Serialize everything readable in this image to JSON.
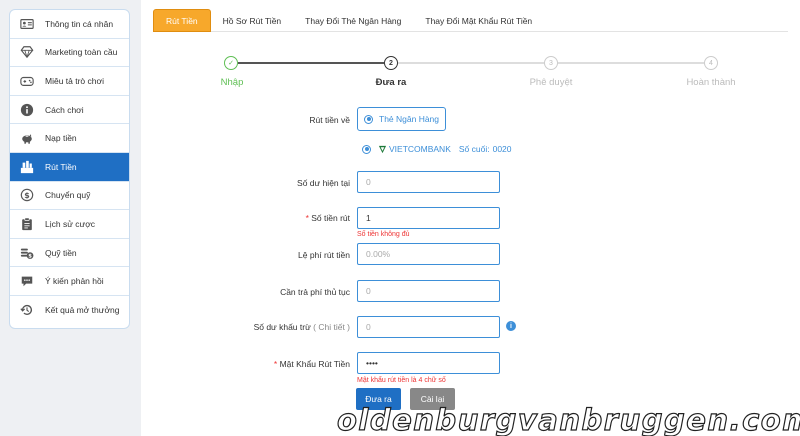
{
  "sidebar": {
    "items": [
      {
        "label": "Thông tin cá nhân",
        "icon": "id-card-icon",
        "active": false
      },
      {
        "label": "Marketing toàn cầu",
        "icon": "diamond-icon",
        "active": false
      },
      {
        "label": "Miêu tả trò chơi",
        "icon": "gamepad-icon",
        "active": false
      },
      {
        "label": "Cách chơi",
        "icon": "info-icon",
        "active": false
      },
      {
        "label": "Nạp tiền",
        "icon": "piggy-bank-icon",
        "active": false
      },
      {
        "label": "Rút Tiền",
        "icon": "withdraw-icon",
        "active": true
      },
      {
        "label": "Chuyển quỹ",
        "icon": "dollar-circle-icon",
        "active": false
      },
      {
        "label": "Lịch sử cược",
        "icon": "clipboard-icon",
        "active": false
      },
      {
        "label": "Quỹ tiền",
        "icon": "coins-icon",
        "active": false
      },
      {
        "label": "Ý kiến phản hồi",
        "icon": "chat-bubble-icon",
        "active": false
      },
      {
        "label": "Kết quả mở thưởng",
        "icon": "history-icon",
        "active": false
      }
    ]
  },
  "tabs": [
    {
      "label": "Rút Tiền",
      "active": true
    },
    {
      "label": "Hồ Sơ Rút Tiền",
      "active": false
    },
    {
      "label": "Thay Đổi Thẻ Ngân Hàng",
      "active": false
    },
    {
      "label": "Thay Đổi Mật Khẩu Rút Tiền",
      "active": false
    }
  ],
  "stepper": {
    "steps": [
      {
        "num": "✓",
        "label": "Nhập",
        "state": "done"
      },
      {
        "num": "2",
        "label": "Đưa ra",
        "state": "current"
      },
      {
        "num": "3",
        "label": "Phê duyệt",
        "state": "todo"
      },
      {
        "num": "4",
        "label": "Hoàn thành",
        "state": "todo"
      }
    ]
  },
  "form": {
    "withdraw_to_label": "Rút tiền về",
    "withdraw_to_option": "Thẻ Ngân Hàng",
    "bank_name": "VIETCOMBANK",
    "last_digits_label": "Số cuối:",
    "last_digits": "0020",
    "balance_label": "Số dư hiện tại",
    "balance_placeholder": "0",
    "amount_label": "Số tiền rút",
    "amount_value": "1",
    "amount_error": "Số tiền không đủ",
    "fee_rate_label": "Lệ phí rút tiền",
    "fee_rate_placeholder": "0.00%",
    "fee_label": "Cần trả phí thủ tục",
    "fee_placeholder": "0",
    "deduct_label": "Số dư khấu trừ",
    "deduct_detail": "( Chi tiết )",
    "deduct_placeholder": "0",
    "password_label": "Mật Khẩu Rút Tiền",
    "password_value": "••••",
    "password_error": "Mật khẩu rút tiền là 4 chữ số",
    "required_mark": "*",
    "info_glyph": "i",
    "submit_label": "Đưa ra",
    "reset_label": "Cài lại"
  },
  "watermark": "oldenburgvanbruggen.com",
  "colors": {
    "primary": "#1f6fc4",
    "tab_active": "#f7a82b",
    "success": "#5fbf54",
    "error": "#e33333",
    "link": "#3d8fd8"
  }
}
